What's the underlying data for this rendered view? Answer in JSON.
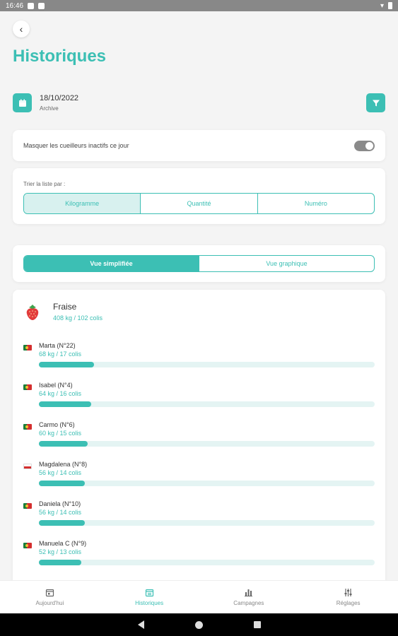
{
  "status_bar": {
    "time": "16:46"
  },
  "page": {
    "title": "Historiques"
  },
  "date": {
    "value": "18/10/2022",
    "subtitle": "Archive"
  },
  "toggle": {
    "label": "Masquer les cueilleurs inactifs ce jour",
    "on": true
  },
  "sort": {
    "label": "Trier la liste par :",
    "options": [
      "Kilogramme",
      "Quantité",
      "Numéro"
    ],
    "active": "Kilogramme"
  },
  "view": {
    "options": [
      "Vue simplifiée",
      "Vue graphique"
    ],
    "active": "Vue simplifiée"
  },
  "fruit": {
    "name": "Fraise",
    "total": "408 kg / 102 colis"
  },
  "pickers": [
    {
      "name": "Marta (N°22)",
      "value": "68 kg / 17 colis",
      "flag": "pt",
      "progress": 0.165
    },
    {
      "name": "Isabel (N°4)",
      "value": "64 kg / 16 colis",
      "flag": "pt",
      "progress": 0.155
    },
    {
      "name": "Carmo (N°6)",
      "value": "60 kg / 15 colis",
      "flag": "pt",
      "progress": 0.146
    },
    {
      "name": "Magdalena (N°8)",
      "value": "56 kg / 14 colis",
      "flag": "pl",
      "progress": 0.136
    },
    {
      "name": "Daniela (N°10)",
      "value": "56 kg / 14 colis",
      "flag": "pt",
      "progress": 0.136
    },
    {
      "name": "Manuela C (N°9)",
      "value": "52 kg / 13 colis",
      "flag": "pt",
      "progress": 0.126
    }
  ],
  "nav": {
    "items": [
      {
        "label": "Aujourd'hui",
        "icon": "calendar-day-icon"
      },
      {
        "label": "Historiques",
        "icon": "calendar-history-icon"
      },
      {
        "label": "Campagnes",
        "icon": "bar-chart-icon"
      },
      {
        "label": "Réglages",
        "icon": "sliders-icon"
      }
    ],
    "active": "Historiques"
  },
  "colors": {
    "accent": "#3cbfb4",
    "accent_light": "#d8f1ef",
    "track": "#e4f4f3"
  }
}
